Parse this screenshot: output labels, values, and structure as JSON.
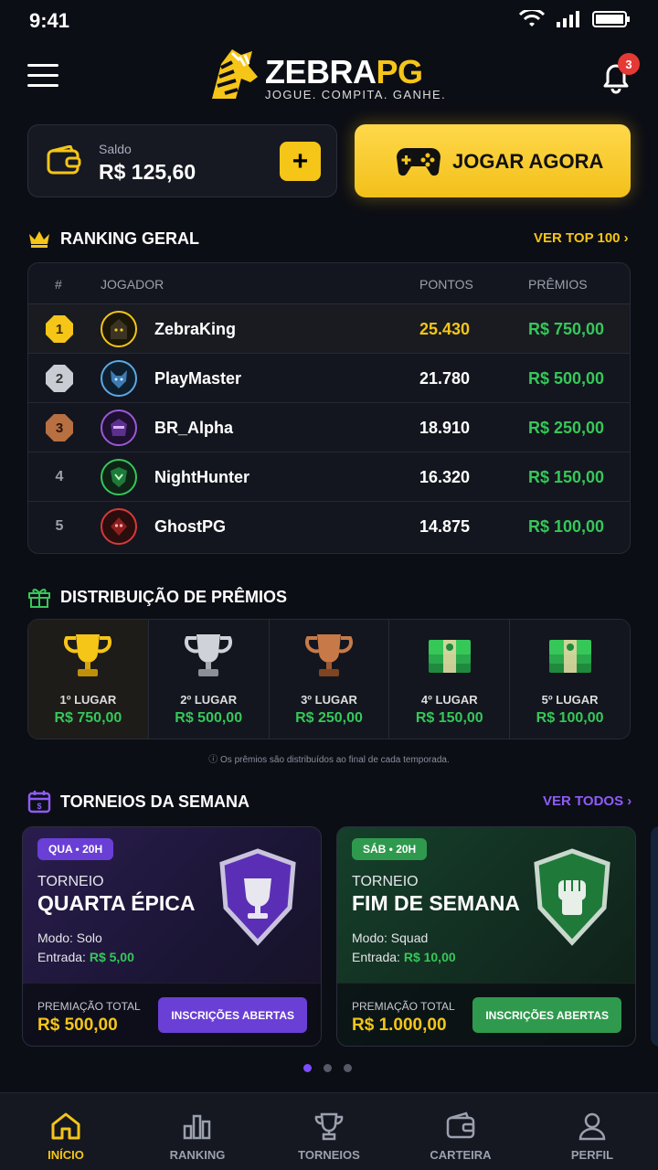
{
  "status": {
    "time": "9:41"
  },
  "header": {
    "brand_main": "ZEBRA",
    "brand_accent": "PG",
    "tagline": "JOGUE. COMPITA. GANHE.",
    "notifications": "3"
  },
  "balance": {
    "label": "Saldo",
    "value": "R$ 125,60",
    "add_label": "+"
  },
  "play": {
    "label": "JOGAR AGORA"
  },
  "ranking": {
    "title": "RANKING GERAL",
    "link": "VER TOP 100",
    "columns": {
      "pos": "#",
      "player": "JOGADOR",
      "points": "PONTOS",
      "prizes": "PRÊMIOS"
    },
    "rows": [
      {
        "pos": "1",
        "name": "ZebraKing",
        "points": "25.430",
        "prize": "R$ 750,00"
      },
      {
        "pos": "2",
        "name": "PlayMaster",
        "points": "21.780",
        "prize": "R$ 500,00"
      },
      {
        "pos": "3",
        "name": "BR_Alpha",
        "points": "18.910",
        "prize": "R$ 250,00"
      },
      {
        "pos": "4",
        "name": "NightHunter",
        "points": "16.320",
        "prize": "R$ 150,00"
      },
      {
        "pos": "5",
        "name": "GhostPG",
        "points": "14.875",
        "prize": "R$ 100,00"
      }
    ]
  },
  "distribution": {
    "title": "DISTRIBUIÇÃO DE PRÊMIOS",
    "items": [
      {
        "place": "1º LUGAR",
        "amount": "R$ 750,00"
      },
      {
        "place": "2º LUGAR",
        "amount": "R$ 500,00"
      },
      {
        "place": "3º LUGAR",
        "amount": "R$ 250,00"
      },
      {
        "place": "4º LUGAR",
        "amount": "R$ 150,00"
      },
      {
        "place": "5º LUGAR",
        "amount": "R$ 100,00"
      }
    ],
    "note": "ⓘ Os prêmios são distribuídos ao final de cada temporada."
  },
  "tournaments": {
    "title": "TORNEIOS DA SEMANA",
    "link": "VER TODOS",
    "cards": [
      {
        "badge": "QUA • 20H",
        "kicker": "TORNEIO",
        "name": "QUARTA ÉPICA",
        "mode": "Modo: Solo",
        "entry_label": "Entrada: ",
        "entry_value": "R$ 5,00",
        "prize_label": "PREMIAÇÃO TOTAL",
        "prize_value": "R$ 500,00",
        "cta": "INSCRIÇÕES ABERTAS"
      },
      {
        "badge": "SÁB • 20H",
        "kicker": "TORNEIO",
        "name": "FIM DE SEMANA",
        "mode": "Modo: Squad",
        "entry_label": "Entrada: ",
        "entry_value": "R$ 10,00",
        "prize_label": "PREMIAÇÃO TOTAL",
        "prize_value": "R$ 1.000,00",
        "cta": "INSCRIÇÕES ABERTAS"
      }
    ]
  },
  "nav": [
    {
      "label": "INÍCIO",
      "icon": "home-icon",
      "active": true
    },
    {
      "label": "RANKING",
      "icon": "bar-chart-icon"
    },
    {
      "label": "TORNEIOS",
      "icon": "trophy-icon"
    },
    {
      "label": "CARTEIRA",
      "icon": "wallet-icon"
    },
    {
      "label": "PERFIL",
      "icon": "user-icon"
    }
  ],
  "colors": {
    "accent": "#f5c518",
    "success": "#36c759",
    "purple": "#6a3fd6",
    "green": "#2f9a4e",
    "background": "#0c0e15"
  }
}
